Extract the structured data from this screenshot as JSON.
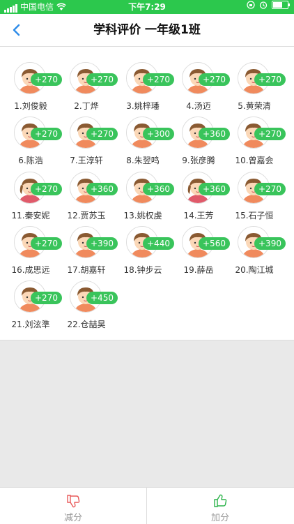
{
  "status": {
    "carrier": "中国电信",
    "time": "下午7:29"
  },
  "header": {
    "title": "学科评价 一年级1班"
  },
  "students": [
    {
      "name": "1.刘俊毅",
      "score": "+270",
      "gender": "boy"
    },
    {
      "name": "2.丁烨",
      "score": "+270",
      "gender": "boy"
    },
    {
      "name": "3.姚梓璠",
      "score": "+270",
      "gender": "boy"
    },
    {
      "name": "4.汤迈",
      "score": "+270",
      "gender": "boy"
    },
    {
      "name": "5.黄荣清",
      "score": "+270",
      "gender": "boy"
    },
    {
      "name": "6.陈浩",
      "score": "+270",
      "gender": "boy"
    },
    {
      "name": "7.王淳轩",
      "score": "+270",
      "gender": "boy"
    },
    {
      "name": "8.朱翌鸣",
      "score": "+300",
      "gender": "boy"
    },
    {
      "name": "9.张彦腾",
      "score": "+360",
      "gender": "boy"
    },
    {
      "name": "10.曾嘉会",
      "score": "+270",
      "gender": "boy"
    },
    {
      "name": "11.秦安妮",
      "score": "+270",
      "gender": "girl"
    },
    {
      "name": "12.贾苏玉",
      "score": "+360",
      "gender": "boy"
    },
    {
      "name": "13.姚权虔",
      "score": "+360",
      "gender": "boy"
    },
    {
      "name": "14.王芳",
      "score": "+360",
      "gender": "girl"
    },
    {
      "name": "15.石子恒",
      "score": "+270",
      "gender": "boy"
    },
    {
      "name": "16.成思远",
      "score": "+270",
      "gender": "boy"
    },
    {
      "name": "17.胡嘉轩",
      "score": "+390",
      "gender": "boy"
    },
    {
      "name": "18.钟步云",
      "score": "+440",
      "gender": "boy"
    },
    {
      "name": "19.薛岳",
      "score": "+560",
      "gender": "boy"
    },
    {
      "name": "20.陶江城",
      "score": "+390",
      "gender": "boy"
    },
    {
      "name": "21.刘泫準",
      "score": "+270",
      "gender": "boy"
    },
    {
      "name": "22.仓喆昊",
      "score": "+450",
      "gender": "boy"
    }
  ],
  "bottom": {
    "minus_label": "减分",
    "plus_label": "加分"
  },
  "colors": {
    "accent": "#2cc84d",
    "badge": "#39c45b",
    "nav_blue": "#2b8ae8",
    "minus_red": "#e85a5a"
  }
}
